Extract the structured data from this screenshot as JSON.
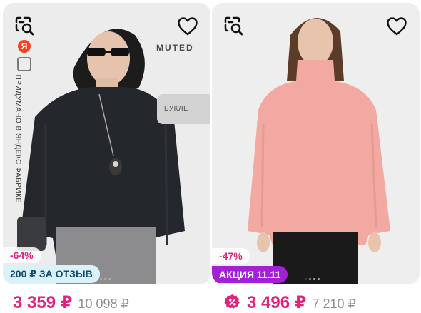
{
  "products": [
    {
      "brand": "MUTED",
      "side_label": "ПРИДУМАНО В ЯНДЕКС ФАБРИКЕ",
      "yandex_letter": "Я",
      "texture_label": "БУКЛЕ",
      "discount": "-64%",
      "promo": "200 ₽ ЗА ОТЗЫВ",
      "price": "3 359 ₽",
      "old_price": "10 098 ₽"
    },
    {
      "discount": "-47%",
      "promo": "АКЦИЯ 11.11",
      "price": "3 496 ₽",
      "old_price": "7 210 ₽"
    }
  ],
  "colors": {
    "accent": "#e0247c",
    "promo_review_bg": "#d9f1f8",
    "promo_action_bg": "#a51fd6",
    "old_price": "#8d8d8d"
  },
  "icons": [
    "image-search-icon",
    "heart-icon",
    "yandex-logo-icon",
    "sale-percent-icon"
  ]
}
